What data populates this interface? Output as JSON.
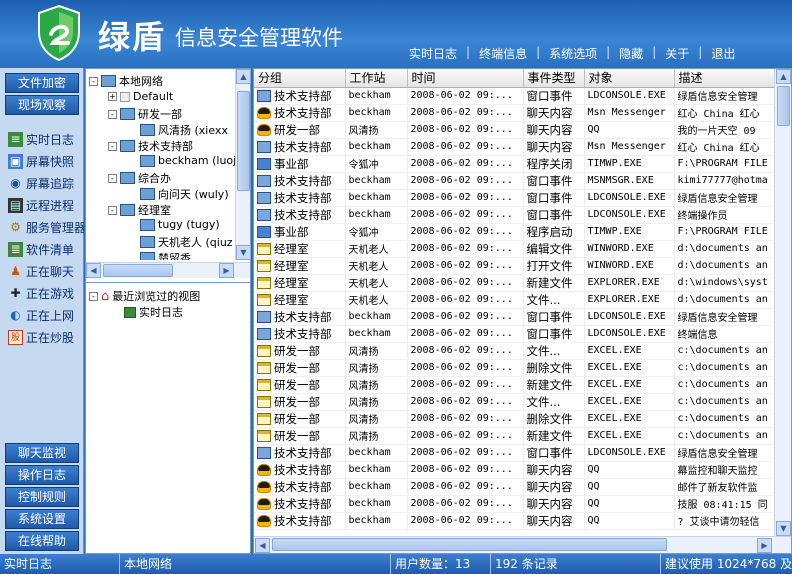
{
  "app": {
    "brand": "绿盾",
    "subtitle": "信息安全管理软件"
  },
  "topnav": [
    "实时日志",
    "终端信息",
    "系统选项",
    "隐藏",
    "关于",
    "退出"
  ],
  "sidebar": {
    "top_buttons": [
      "文件加密",
      "现场观察"
    ],
    "nav": [
      {
        "label": "实时日志",
        "icon": "log-icon"
      },
      {
        "label": "屏幕快照",
        "icon": "screenshot-icon"
      },
      {
        "label": "屏幕追踪",
        "icon": "screen-track-icon"
      },
      {
        "label": "远程进程",
        "icon": "process-icon"
      },
      {
        "label": "服务管理器",
        "icon": "service-icon"
      },
      {
        "label": "软件清单",
        "icon": "software-icon"
      },
      {
        "label": "正在聊天",
        "icon": "chat-icon"
      },
      {
        "label": "正在游戏",
        "icon": "game-icon"
      },
      {
        "label": "正在上网",
        "icon": "web-icon"
      },
      {
        "label": "正在炒股",
        "icon": "stock-icon"
      }
    ],
    "bottom_buttons": [
      "聊天监视",
      "操作日志",
      "控制规则",
      "系统设置",
      "在线帮助"
    ]
  },
  "tree": {
    "root": "本地网络",
    "nodes": [
      {
        "label": "Default",
        "level": 1,
        "expander": "+"
      },
      {
        "label": "研发一部",
        "level": 1,
        "expander": "-"
      },
      {
        "label": "风清扬  (xiexx",
        "level": 2
      },
      {
        "label": "技术支持部",
        "level": 1,
        "expander": "-"
      },
      {
        "label": "beckham  (luojr",
        "level": 2
      },
      {
        "label": "综合办",
        "level": 1,
        "expander": "-"
      },
      {
        "label": "向问天  (wuly)",
        "level": 2
      },
      {
        "label": "经理室",
        "level": 1,
        "expander": "-"
      },
      {
        "label": "tugy  (tugy)",
        "level": 2
      },
      {
        "label": "天机老人  (qiuz",
        "level": 2
      },
      {
        "label": "楚留香",
        "level": 2
      }
    ]
  },
  "recent": {
    "title": "最近浏览过的视图",
    "items": [
      "实时日志"
    ]
  },
  "table": {
    "headers": [
      "分组",
      "工作站",
      "时间",
      "事件类型",
      "对象",
      "描述"
    ],
    "rows": [
      {
        "icon": "app",
        "cells": [
          "技术支持部",
          "beckham",
          "2008-06-02 09:...",
          "窗口事件",
          "LDCONSOLE.EXE",
          "绿盾信息安全管理"
        ]
      },
      {
        "icon": "chat",
        "cells": [
          "技术支持部",
          "beckham",
          "2008-06-02 09:...",
          "聊天内容",
          "Msn Messenger",
          "红心  China 红心"
        ]
      },
      {
        "icon": "chat",
        "cells": [
          "研发一部",
          "风清扬",
          "2008-06-02 09:...",
          "聊天内容",
          "QQ",
          "我的一片天空 09"
        ]
      },
      {
        "icon": "app",
        "cells": [
          "技术支持部",
          "beckham",
          "2008-06-02 09:...",
          "聊天内容",
          "Msn Messenger",
          "红心  China 红心"
        ]
      },
      {
        "icon": "prog",
        "cells": [
          "事业部",
          "令狐冲",
          "2008-06-02 09:...",
          "程序关闭",
          "TIMWP.EXE",
          "F:\\PROGRAM FILE"
        ]
      },
      {
        "icon": "app",
        "cells": [
          "技术支持部",
          "beckham",
          "2008-06-02 09:...",
          "窗口事件",
          "MSNMSGR.EXE",
          "kimi77777@hotma"
        ]
      },
      {
        "icon": "app",
        "cells": [
          "技术支持部",
          "beckham",
          "2008-06-02 09:...",
          "窗口事件",
          "LDCONSOLE.EXE",
          "绿盾信息安全管理"
        ]
      },
      {
        "icon": "app",
        "cells": [
          "技术支持部",
          "beckham",
          "2008-06-02 09:...",
          "窗口事件",
          "LDCONSOLE.EXE",
          "终端操作员"
        ]
      },
      {
        "icon": "prog",
        "cells": [
          "事业部",
          "令狐冲",
          "2008-06-02 09:...",
          "程序启动",
          "TIMWP.EXE",
          "F:\\PROGRAM FILE"
        ]
      },
      {
        "icon": "file",
        "cells": [
          "经理室",
          "天机老人",
          "2008-06-02 09:...",
          "编辑文件",
          "WINWORD.EXE",
          "d:\\documents an"
        ]
      },
      {
        "icon": "file",
        "cells": [
          "经理室",
          "天机老人",
          "2008-06-02 09:...",
          "打开文件",
          "WINWORD.EXE",
          "d:\\documents an"
        ]
      },
      {
        "icon": "file",
        "cells": [
          "经理室",
          "天机老人",
          "2008-06-02 09:...",
          "新建文件",
          "EXPLORER.EXE",
          "d:\\windows\\syst"
        ]
      },
      {
        "icon": "file",
        "cells": [
          "经理室",
          "天机老人",
          "2008-06-02 09:...",
          "文件...",
          "EXPLORER.EXE",
          "d:\\documents an"
        ]
      },
      {
        "icon": "app",
        "cells": [
          "技术支持部",
          "beckham",
          "2008-06-02 09:...",
          "窗口事件",
          "LDCONSOLE.EXE",
          "绿盾信息安全管理"
        ]
      },
      {
        "icon": "app",
        "cells": [
          "技术支持部",
          "beckham",
          "2008-06-02 09:...",
          "窗口事件",
          "LDCONSOLE.EXE",
          "终端信息"
        ]
      },
      {
        "icon": "file",
        "cells": [
          "研发一部",
          "风清扬",
          "2008-06-02 09:...",
          "文件...",
          "EXCEL.EXE",
          "c:\\documents an"
        ]
      },
      {
        "icon": "file",
        "cells": [
          "研发一部",
          "风清扬",
          "2008-06-02 09:...",
          "删除文件",
          "EXCEL.EXE",
          "c:\\documents an"
        ]
      },
      {
        "icon": "file",
        "cells": [
          "研发一部",
          "风清扬",
          "2008-06-02 09:...",
          "新建文件",
          "EXCEL.EXE",
          "c:\\documents an"
        ]
      },
      {
        "icon": "file",
        "cells": [
          "研发一部",
          "风清扬",
          "2008-06-02 09:...",
          "文件...",
          "EXCEL.EXE",
          "c:\\documents an"
        ]
      },
      {
        "icon": "file",
        "cells": [
          "研发一部",
          "风清扬",
          "2008-06-02 09:...",
          "删除文件",
          "EXCEL.EXE",
          "c:\\documents an"
        ]
      },
      {
        "icon": "file",
        "cells": [
          "研发一部",
          "风清扬",
          "2008-06-02 09:...",
          "新建文件",
          "EXCEL.EXE",
          "c:\\documents an"
        ]
      },
      {
        "icon": "app",
        "cells": [
          "技术支持部",
          "beckham",
          "2008-06-02 09:...",
          "窗口事件",
          "LDCONSOLE.EXE",
          "绿盾信息安全管理"
        ]
      },
      {
        "icon": "chat",
        "cells": [
          "技术支持部",
          "beckham",
          "2008-06-02 09:...",
          "聊天内容",
          "QQ",
          "幕监控和聊天监控"
        ]
      },
      {
        "icon": "chat",
        "cells": [
          "技术支持部",
          "beckham",
          "2008-06-02 09:...",
          "聊天内容",
          "QQ",
          "邮件了新友软件监"
        ]
      },
      {
        "icon": "chat",
        "cells": [
          "技术支持部",
          "beckham",
          "2008-06-02 09:...",
          "聊天内容",
          "QQ",
          "技服  08:41:15 同"
        ]
      },
      {
        "icon": "chat",
        "cells": [
          "技术支持部",
          "beckham",
          "2008-06-02 09:...",
          "聊天内容",
          "QQ",
          "? 艾谈中请勿轻信"
        ]
      }
    ]
  },
  "status": {
    "view": "实时日志",
    "scope": "本地网络",
    "users": "用户数量：13",
    "records": "192 条记录",
    "hint": "建议使用 1024*768 及更"
  },
  "colors": {
    "header": "#2a70c0",
    "sidebar": "#c5d9f0",
    "accent": "#1f5aa8"
  }
}
